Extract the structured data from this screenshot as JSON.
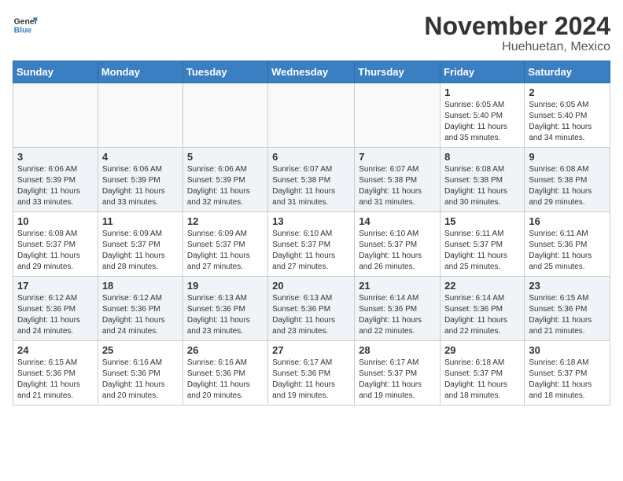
{
  "logo": {
    "line1": "General",
    "line2": "Blue"
  },
  "title": "November 2024",
  "subtitle": "Huehuetan, Mexico",
  "days_of_week": [
    "Sunday",
    "Monday",
    "Tuesday",
    "Wednesday",
    "Thursday",
    "Friday",
    "Saturday"
  ],
  "weeks": [
    [
      {
        "day": "",
        "info": ""
      },
      {
        "day": "",
        "info": ""
      },
      {
        "day": "",
        "info": ""
      },
      {
        "day": "",
        "info": ""
      },
      {
        "day": "",
        "info": ""
      },
      {
        "day": "1",
        "info": "Sunrise: 6:05 AM\nSunset: 5:40 PM\nDaylight: 11 hours and 35 minutes."
      },
      {
        "day": "2",
        "info": "Sunrise: 6:05 AM\nSunset: 5:40 PM\nDaylight: 11 hours and 34 minutes."
      }
    ],
    [
      {
        "day": "3",
        "info": "Sunrise: 6:06 AM\nSunset: 5:39 PM\nDaylight: 11 hours and 33 minutes."
      },
      {
        "day": "4",
        "info": "Sunrise: 6:06 AM\nSunset: 5:39 PM\nDaylight: 11 hours and 33 minutes."
      },
      {
        "day": "5",
        "info": "Sunrise: 6:06 AM\nSunset: 5:39 PM\nDaylight: 11 hours and 32 minutes."
      },
      {
        "day": "6",
        "info": "Sunrise: 6:07 AM\nSunset: 5:38 PM\nDaylight: 11 hours and 31 minutes."
      },
      {
        "day": "7",
        "info": "Sunrise: 6:07 AM\nSunset: 5:38 PM\nDaylight: 11 hours and 31 minutes."
      },
      {
        "day": "8",
        "info": "Sunrise: 6:08 AM\nSunset: 5:38 PM\nDaylight: 11 hours and 30 minutes."
      },
      {
        "day": "9",
        "info": "Sunrise: 6:08 AM\nSunset: 5:38 PM\nDaylight: 11 hours and 29 minutes."
      }
    ],
    [
      {
        "day": "10",
        "info": "Sunrise: 6:08 AM\nSunset: 5:37 PM\nDaylight: 11 hours and 29 minutes."
      },
      {
        "day": "11",
        "info": "Sunrise: 6:09 AM\nSunset: 5:37 PM\nDaylight: 11 hours and 28 minutes."
      },
      {
        "day": "12",
        "info": "Sunrise: 6:09 AM\nSunset: 5:37 PM\nDaylight: 11 hours and 27 minutes."
      },
      {
        "day": "13",
        "info": "Sunrise: 6:10 AM\nSunset: 5:37 PM\nDaylight: 11 hours and 27 minutes."
      },
      {
        "day": "14",
        "info": "Sunrise: 6:10 AM\nSunset: 5:37 PM\nDaylight: 11 hours and 26 minutes."
      },
      {
        "day": "15",
        "info": "Sunrise: 6:11 AM\nSunset: 5:37 PM\nDaylight: 11 hours and 25 minutes."
      },
      {
        "day": "16",
        "info": "Sunrise: 6:11 AM\nSunset: 5:36 PM\nDaylight: 11 hours and 25 minutes."
      }
    ],
    [
      {
        "day": "17",
        "info": "Sunrise: 6:12 AM\nSunset: 5:36 PM\nDaylight: 11 hours and 24 minutes."
      },
      {
        "day": "18",
        "info": "Sunrise: 6:12 AM\nSunset: 5:36 PM\nDaylight: 11 hours and 24 minutes."
      },
      {
        "day": "19",
        "info": "Sunrise: 6:13 AM\nSunset: 5:36 PM\nDaylight: 11 hours and 23 minutes."
      },
      {
        "day": "20",
        "info": "Sunrise: 6:13 AM\nSunset: 5:36 PM\nDaylight: 11 hours and 23 minutes."
      },
      {
        "day": "21",
        "info": "Sunrise: 6:14 AM\nSunset: 5:36 PM\nDaylight: 11 hours and 22 minutes."
      },
      {
        "day": "22",
        "info": "Sunrise: 6:14 AM\nSunset: 5:36 PM\nDaylight: 11 hours and 22 minutes."
      },
      {
        "day": "23",
        "info": "Sunrise: 6:15 AM\nSunset: 5:36 PM\nDaylight: 11 hours and 21 minutes."
      }
    ],
    [
      {
        "day": "24",
        "info": "Sunrise: 6:15 AM\nSunset: 5:36 PM\nDaylight: 11 hours and 21 minutes."
      },
      {
        "day": "25",
        "info": "Sunrise: 6:16 AM\nSunset: 5:36 PM\nDaylight: 11 hours and 20 minutes."
      },
      {
        "day": "26",
        "info": "Sunrise: 6:16 AM\nSunset: 5:36 PM\nDaylight: 11 hours and 20 minutes."
      },
      {
        "day": "27",
        "info": "Sunrise: 6:17 AM\nSunset: 5:36 PM\nDaylight: 11 hours and 19 minutes."
      },
      {
        "day": "28",
        "info": "Sunrise: 6:17 AM\nSunset: 5:37 PM\nDaylight: 11 hours and 19 minutes."
      },
      {
        "day": "29",
        "info": "Sunrise: 6:18 AM\nSunset: 5:37 PM\nDaylight: 11 hours and 18 minutes."
      },
      {
        "day": "30",
        "info": "Sunrise: 6:18 AM\nSunset: 5:37 PM\nDaylight: 11 hours and 18 minutes."
      }
    ]
  ]
}
